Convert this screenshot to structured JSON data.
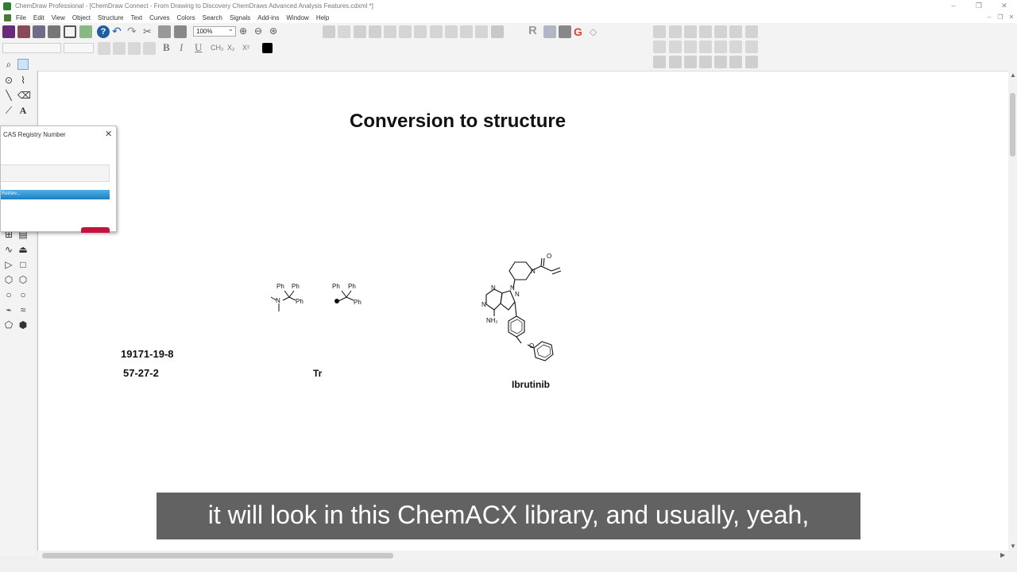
{
  "window": {
    "title": "ChemDraw Professional - [ChemDraw Connect - From Drawing to Discovery ChemDraws Advanced Analysis Features.cdxml *]",
    "controls": [
      "–",
      "❐",
      "✕"
    ]
  },
  "menu": [
    "File",
    "Edit",
    "View",
    "Object",
    "Structure",
    "Text",
    "Curves",
    "Colors",
    "Search",
    "Signals",
    "Add-ins",
    "Window",
    "Help"
  ],
  "toolbar": {
    "zoom_value": "100%",
    "format_glyphs": [
      "B",
      "I",
      "U"
    ],
    "format_small": [
      "CH₂",
      "X₂",
      "X²"
    ]
  },
  "document": {
    "heading": "Conversion to structure",
    "cas_numbers": [
      "19171-19-8",
      "57-27-2"
    ],
    "labels": {
      "trityl": "Tr",
      "drug": "Ibrutinib"
    },
    "atoms": {
      "ph": "Ph",
      "n": "N",
      "o": "O",
      "nh2": "NH₂"
    }
  },
  "dialog": {
    "title": "CAS Registry Number",
    "progress_text": "Retriev...",
    "close": "✕"
  },
  "caption": "it will look in this ChemACX library, and usually, yeah,",
  "colors": {
    "progress": "#2d8fcf",
    "cancel_button": "#c2133f",
    "caption_bg": "#484848"
  }
}
